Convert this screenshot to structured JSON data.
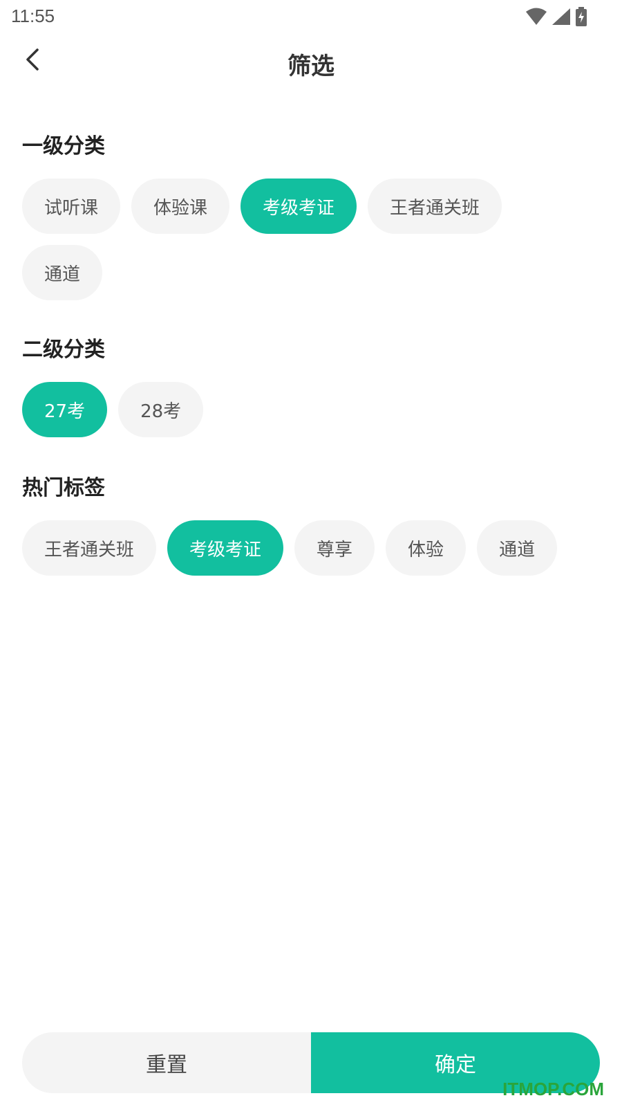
{
  "status_bar": {
    "time": "11:55",
    "icons": [
      "wifi-icon",
      "signal-icon",
      "battery-charging-icon"
    ]
  },
  "header": {
    "title": "筛选",
    "back_icon": "chevron-left-icon"
  },
  "sections": [
    {
      "title": "一级分类",
      "chips": [
        {
          "label": "试听课",
          "selected": false
        },
        {
          "label": "体验课",
          "selected": false
        },
        {
          "label": "考级考证",
          "selected": true
        },
        {
          "label": "王者通关班",
          "selected": false
        },
        {
          "label": "通道",
          "selected": false
        }
      ]
    },
    {
      "title": "二级分类",
      "chips": [
        {
          "label": "27考",
          "selected": true
        },
        {
          "label": "28考",
          "selected": false
        }
      ]
    },
    {
      "title": "热门标签",
      "chips": [
        {
          "label": "王者通关班",
          "selected": false
        },
        {
          "label": "考级考证",
          "selected": true
        },
        {
          "label": "尊享",
          "selected": false
        },
        {
          "label": "体验",
          "selected": false
        },
        {
          "label": "通道",
          "selected": false
        }
      ]
    }
  ],
  "footer": {
    "reset_label": "重置",
    "confirm_label": "确定"
  },
  "watermark": "ITMOP.COM",
  "colors": {
    "accent": "#12bf9f",
    "chip_bg": "#f4f4f4",
    "watermark": "#2aa53b"
  }
}
